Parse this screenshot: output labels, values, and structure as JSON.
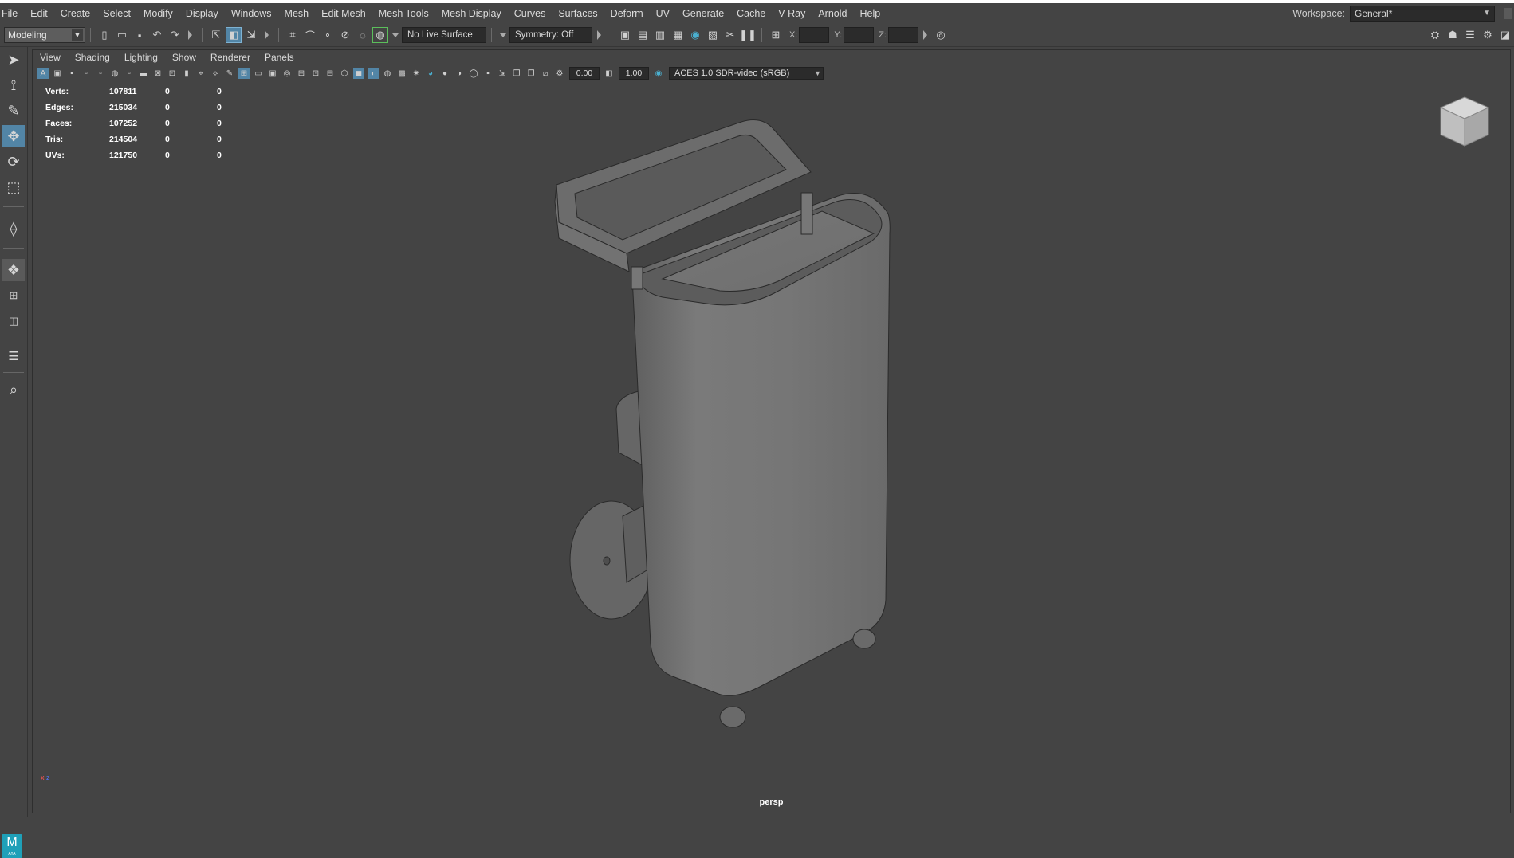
{
  "menubar": {
    "items": [
      "File",
      "Edit",
      "Create",
      "Select",
      "Modify",
      "Display",
      "Windows",
      "Mesh",
      "Edit Mesh",
      "Mesh Tools",
      "Mesh Display",
      "Curves",
      "Surfaces",
      "Deform",
      "UV",
      "Generate",
      "Cache",
      "V-Ray",
      "Arnold",
      "Help"
    ]
  },
  "workspace": {
    "label": "Workspace:",
    "value": "General*"
  },
  "statusline": {
    "mode": "Modeling",
    "live_surface": "No Live Surface",
    "symmetry": "Symmetry: Off",
    "x_label": "X:",
    "y_label": "Y:",
    "z_label": "Z:"
  },
  "panel": {
    "menus": [
      "View",
      "Shading",
      "Lighting",
      "Show",
      "Renderer",
      "Panels"
    ],
    "exposure": "0.00",
    "gamma": "1.00",
    "colorspace": "ACES 1.0 SDR-video (sRGB)",
    "camera": "persp"
  },
  "hud": {
    "rows": [
      {
        "label": "Verts:",
        "v1": "107811",
        "v2": "0",
        "v3": "0"
      },
      {
        "label": "Edges:",
        "v1": "215034",
        "v2": "0",
        "v3": "0"
      },
      {
        "label": "Faces:",
        "v1": "107252",
        "v2": "0",
        "v3": "0"
      },
      {
        "label": "Tris:",
        "v1": "214504",
        "v2": "0",
        "v3": "0"
      },
      {
        "label": "UVs:",
        "v1": "121750",
        "v2": "0",
        "v3": "0"
      }
    ]
  },
  "logo": {
    "letter": "M",
    "sub": "AYA"
  },
  "axis": {
    "x": "x",
    "z": "z"
  },
  "colors": {
    "accent": "#5285a6",
    "background": "#444444",
    "viewport": "#444444"
  }
}
